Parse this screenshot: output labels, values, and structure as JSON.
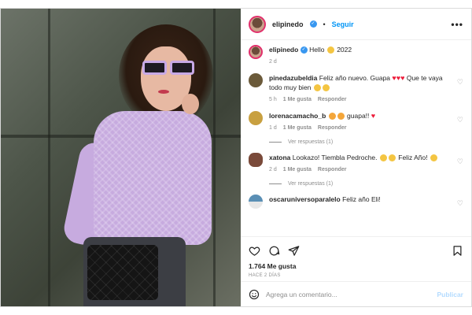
{
  "post": {
    "username": "elipinedo",
    "follow_label": "Seguir",
    "separator": "•",
    "more_label": "•••"
  },
  "caption": {
    "username": "elipinedo",
    "text_before": "Hello",
    "text_after": "2022",
    "age": "2 d"
  },
  "comments": [
    {
      "username": "pinedazubeldia",
      "text": "Feliz año nuevo. Guapa",
      "text_after": "Que te vaya todo muy bien",
      "age": "5 h",
      "likes": "1 Me gusta",
      "reply_label": "Responder",
      "avatar_color": "#6b5a3a"
    },
    {
      "username": "lorenacamacho_b",
      "text": "guapa!!",
      "age": "1 d",
      "likes": "1 Me gusta",
      "reply_label": "Responder",
      "replies_label": "Ver respuestas (1)",
      "avatar_color": "#c8a040"
    },
    {
      "username": "xatona",
      "text": "Lookazo! Tiembla Pedroche.",
      "text_after": "Feliz Año!",
      "age": "2 d",
      "likes": "1 Me gusta",
      "reply_label": "Responder",
      "replies_label": "Ver respuestas (1)",
      "avatar_color": "#7a4a3a"
    },
    {
      "username": "oscaruniversoparalelo",
      "text": "Feliz año Eli!",
      "avatar_color": "#5a8fb5"
    }
  ],
  "footer": {
    "likes_count": "1.764 Me gusta",
    "time_ago": "HACE 2 DÍAS",
    "comment_placeholder": "Agrega un comentario...",
    "publish_label": "Publicar"
  },
  "colors": {
    "accent": "#0095f6",
    "verified": "#3897f0",
    "heart": "#ed1c3a",
    "muted": "#8e8e8e"
  }
}
